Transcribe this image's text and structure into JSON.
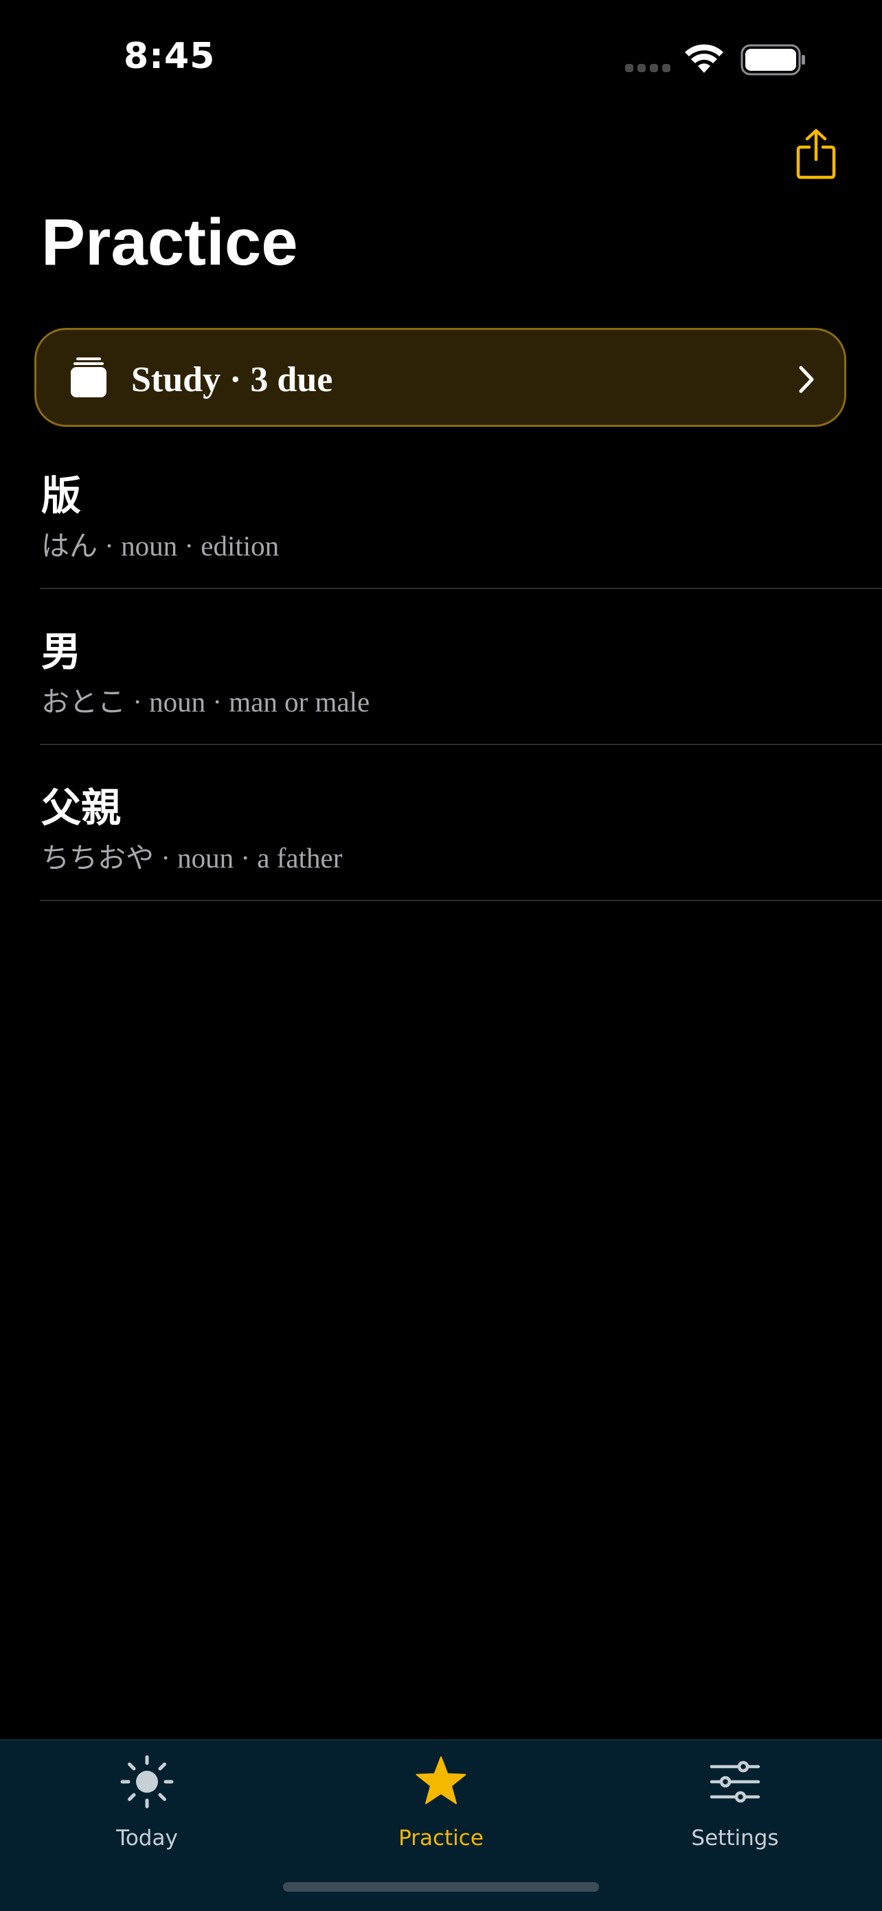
{
  "status_bar": {
    "time": "8:45"
  },
  "header": {
    "title": "Practice",
    "share_icon": "share-icon"
  },
  "study_banner": {
    "label": "Study · 3 due",
    "icon": "card-stack-icon",
    "chevron": "chevron-right-icon"
  },
  "vocab": [
    {
      "kanji": "版",
      "detail": "はん · noun · edition"
    },
    {
      "kanji": "男",
      "detail": "おとこ · noun · man or male"
    },
    {
      "kanji": "父親",
      "detail": "ちちおや · noun · a father"
    }
  ],
  "tab_bar": {
    "tabs": [
      {
        "label": "Today",
        "icon": "sun-icon",
        "active": false
      },
      {
        "label": "Practice",
        "icon": "star-icon",
        "active": true
      },
      {
        "label": "Settings",
        "icon": "sliders-icon",
        "active": false
      }
    ]
  },
  "colors": {
    "accent": "#f5b800",
    "background": "#000000",
    "tab_bar": "#04202f",
    "banner_bg": "#2e2206",
    "banner_border": "#8a6a14",
    "secondary_text": "#a8a8ad"
  }
}
